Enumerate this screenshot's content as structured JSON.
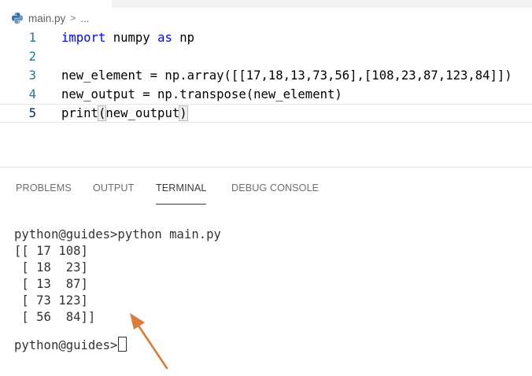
{
  "breadcrumb": {
    "file_icon": "python-file-icon",
    "file_name": "main.py",
    "separator": ">",
    "ellipsis": "..."
  },
  "editor": {
    "lines": [
      {
        "number": "1",
        "tokens": [
          {
            "t": "import",
            "kw": true
          },
          {
            "t": " numpy "
          },
          {
            "t": "as",
            "kw": true
          },
          {
            "t": " np"
          }
        ]
      },
      {
        "number": "2",
        "tokens": []
      },
      {
        "number": "3",
        "tokens": [
          {
            "t": "new_element = np.array([[17,18,13,73,56],[108,23,87,123,84]])"
          }
        ]
      },
      {
        "number": "4",
        "tokens": [
          {
            "t": "new_output = np.transpose(new_element)"
          }
        ]
      },
      {
        "number": "5",
        "tokens": [
          {
            "t": "print"
          },
          {
            "t": "(",
            "bracket": true
          },
          {
            "t": "new_output"
          },
          {
            "t": ")",
            "bracket": true
          }
        ],
        "active": true
      }
    ]
  },
  "panel": {
    "tabs": [
      {
        "label": "PROBLEMS",
        "active": false
      },
      {
        "label": "OUTPUT",
        "active": false
      },
      {
        "label": "TERMINAL",
        "active": true
      },
      {
        "label": "DEBUG CONSOLE",
        "active": false
      }
    ]
  },
  "terminal": {
    "command_line": "python@guides>python main.py",
    "output": [
      "[[ 17 108]",
      " [ 18  23]",
      " [ 13  87]",
      " [ 73 123]",
      " [ 56  84]]"
    ],
    "prompt": "python@guides>"
  },
  "colors": {
    "keyword": "#0000ff",
    "line_number": "#237893",
    "annotation_arrow": "#e07a3a"
  }
}
